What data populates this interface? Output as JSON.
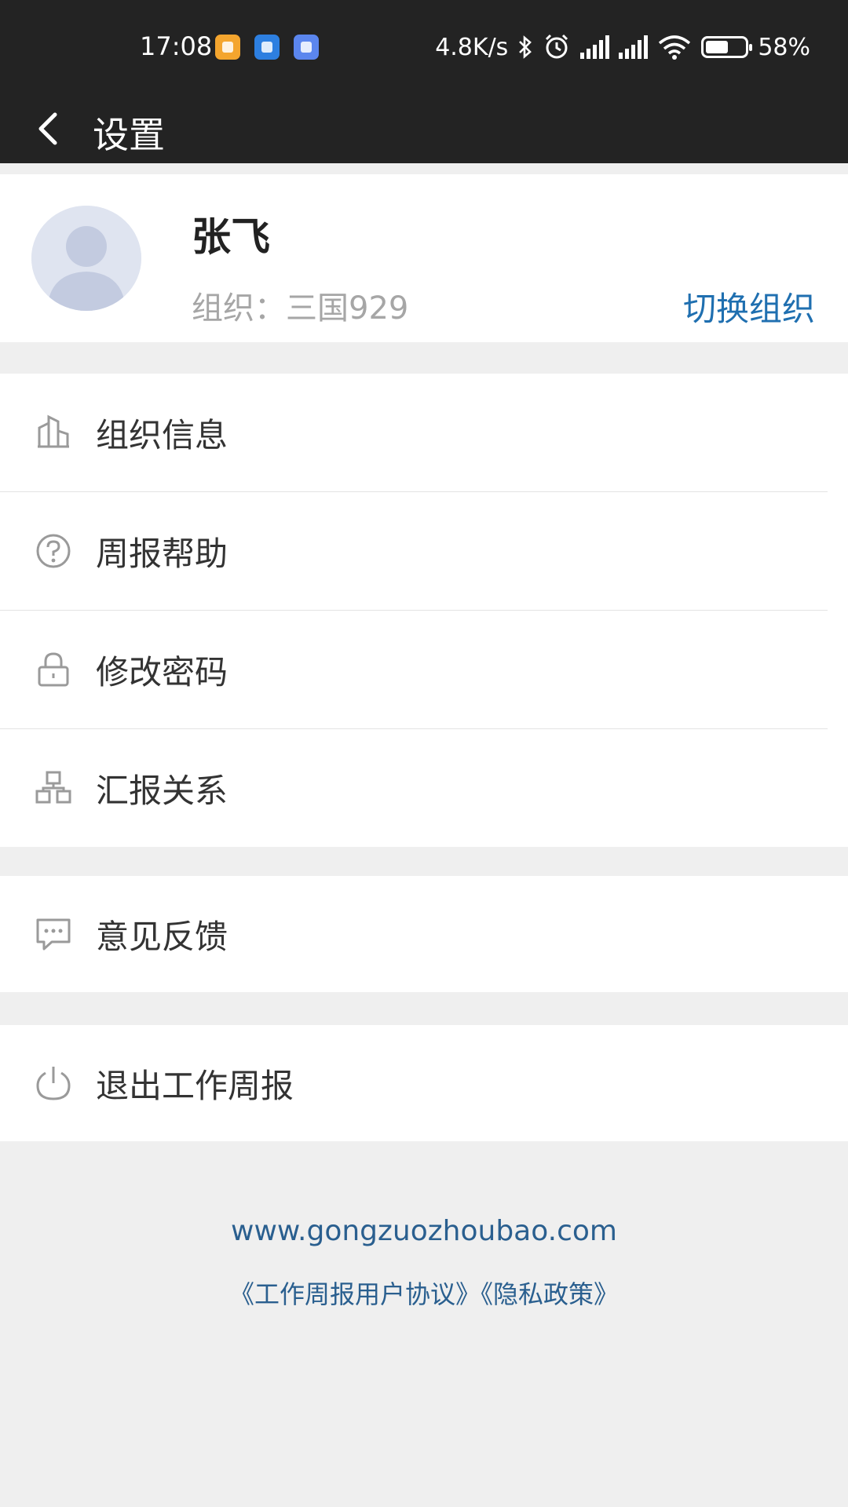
{
  "status_bar": {
    "time": "17:08",
    "speed": "4.8K/s",
    "battery_percent_text": "58%",
    "battery_level": 0.58
  },
  "header": {
    "title": "设置",
    "back_icon": "chevron-left-icon"
  },
  "profile": {
    "name": "张飞",
    "org_label": "组织：",
    "org_name": "三国929",
    "switch_org": "切换组织"
  },
  "menu_groups": [
    [
      {
        "label": "组织信息",
        "icon": "building-icon"
      },
      {
        "label": "周报帮助",
        "icon": "question-icon"
      },
      {
        "label": "修改密码",
        "icon": "lock-icon"
      },
      {
        "label": "汇报关系",
        "icon": "hierarchy-icon"
      }
    ],
    [
      {
        "label": "意见反馈",
        "icon": "chat-icon"
      }
    ],
    [
      {
        "label": "退出工作周报",
        "icon": "power-icon"
      }
    ]
  ],
  "footer": {
    "url": "www.gongzuozhoubao.com",
    "agreement": "《工作周报用户协议》",
    "privacy": "《隐私政策》"
  },
  "colors": {
    "header_bg": "#232323",
    "accent": "#1f6fb0",
    "footer_link": "#2a5f8f"
  }
}
